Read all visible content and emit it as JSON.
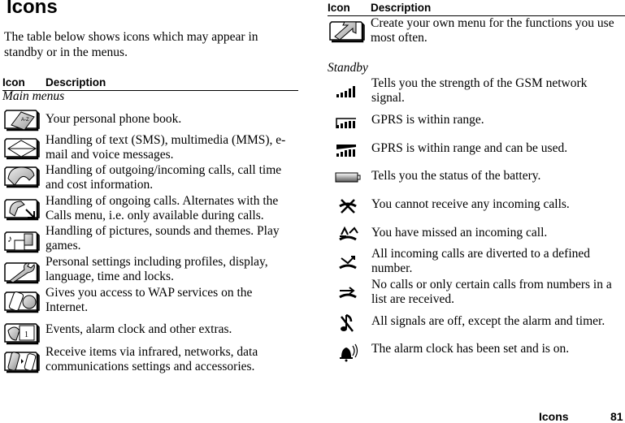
{
  "page": {
    "title": "Icons",
    "intro": "The table below shows icons which may appear in standby or in the menus.",
    "footer": {
      "section": "Icons",
      "page_number": "81"
    }
  },
  "table": {
    "header": {
      "icon": "Icon",
      "description": "Description"
    },
    "main_menus": {
      "label": "Main menus",
      "items": [
        {
          "icon": "phonebook-icon",
          "description": "Your personal phone book."
        },
        {
          "icon": "envelope-icon",
          "description": "Handling of text (SMS), multimedia (MMS), e-mail and voice messages."
        },
        {
          "icon": "phone-handset-icon",
          "description": "Handling of outgoing/incoming calls, call time and cost information."
        },
        {
          "icon": "ongoing-call-icon",
          "description": "Handling of ongoing calls. Alternates with the Calls menu, i.e. only available during calls."
        },
        {
          "icon": "entertainment-icon",
          "description": "Handling of pictures, sounds and themes. Play games."
        },
        {
          "icon": "wrench-icon",
          "description": "Personal settings including profiles, display, language, time and locks."
        },
        {
          "icon": "internet-icon",
          "description": "Gives you access to WAP services on the Internet."
        },
        {
          "icon": "organizer-icon",
          "description": "Events, alarm clock and other extras."
        },
        {
          "icon": "connectivity-icon",
          "description": "Receive items via infrared, networks, data communications settings and accessories."
        },
        {
          "icon": "shortcut-arrow-icon",
          "description": "Create your own menu for the functions you use most often."
        }
      ]
    },
    "standby": {
      "label": "Standby",
      "items": [
        {
          "icon": "signal-strength-icon",
          "description": "Tells you the strength of the GSM network signal."
        },
        {
          "icon": "gprs-range-icon",
          "description": "GPRS is within range."
        },
        {
          "icon": "gprs-usable-icon",
          "description": "GPRS is within range and can be used."
        },
        {
          "icon": "battery-icon",
          "description": "Tells you the status of the battery."
        },
        {
          "icon": "no-calls-icon",
          "description": "You cannot receive any incoming calls."
        },
        {
          "icon": "missed-call-icon",
          "description": "You have missed an incoming call."
        },
        {
          "icon": "call-divert-icon",
          "description": "All incoming calls are diverted to a defined number."
        },
        {
          "icon": "restricted-calls-icon",
          "description": "No calls or only certain calls from numbers in a list are received."
        },
        {
          "icon": "silent-icon",
          "description": "All signals are off, except the alarm and timer."
        },
        {
          "icon": "alarm-icon",
          "description": "The alarm clock has been set and is on."
        }
      ]
    }
  }
}
